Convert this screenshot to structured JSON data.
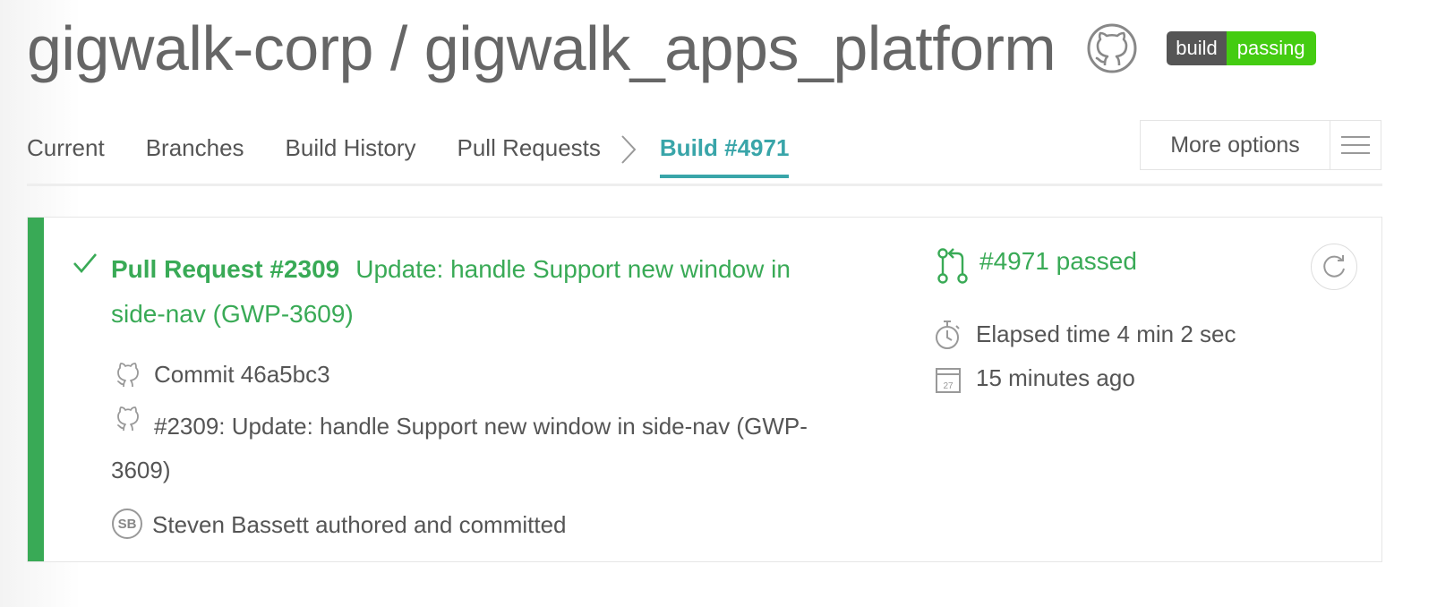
{
  "header": {
    "repo_title": "gigwalk-corp / gigwalk_apps_platform",
    "github_icon": "github-icon",
    "badge": {
      "left": "build",
      "right": "passing",
      "left_color": "#555555",
      "right_color": "#44cc11"
    }
  },
  "tabs": {
    "items": [
      "Current",
      "Branches",
      "Build History",
      "Pull Requests"
    ],
    "active": "Build #4971"
  },
  "more_options": {
    "label": "More options",
    "menu_icon": "hamburger-menu-icon"
  },
  "build": {
    "status_color": "#39aa56",
    "pr_number": "Pull Request #2309",
    "pr_title": "Update: handle Support new window in side-nav (GWP-3609)",
    "commit": "Commit 46a5bc3",
    "commit_message": "#2309: Update: handle Support new window in side-nav (GWP-3609)",
    "author_initials": "SB",
    "author_line": "Steven Bassett authored and committed",
    "build_status": "#4971 passed",
    "elapsed": "Elapsed time 4 min 2 sec",
    "finished": "15 minutes ago",
    "calendar_day": "27"
  }
}
